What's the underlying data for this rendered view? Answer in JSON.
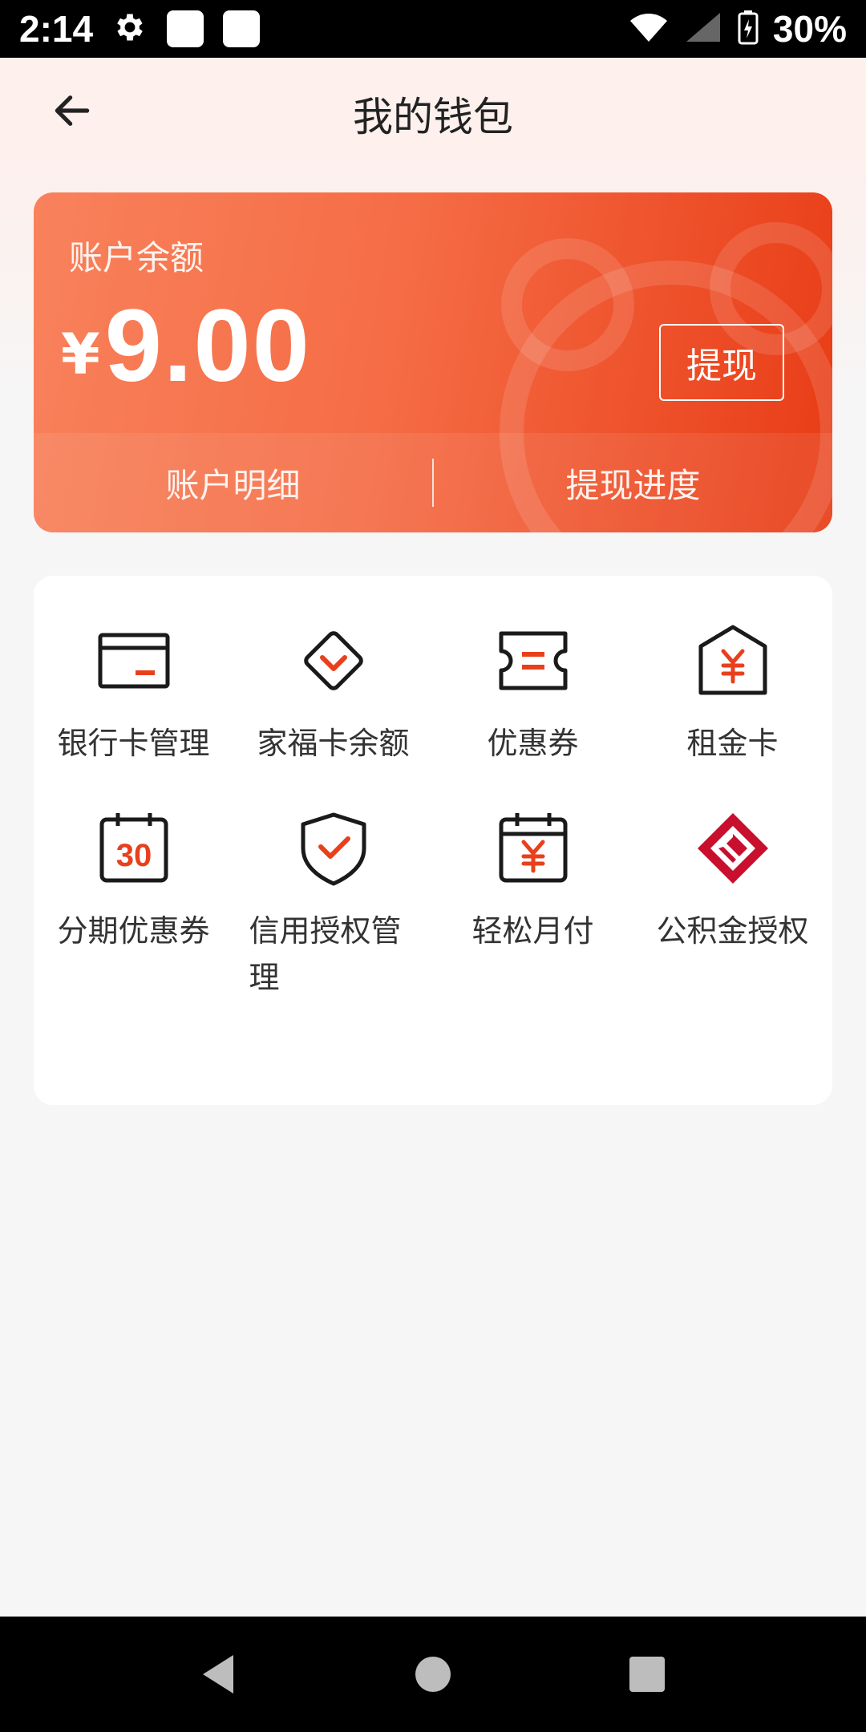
{
  "status_bar": {
    "time": "2:14",
    "battery": "30%"
  },
  "header": {
    "title": "我的钱包"
  },
  "balance_card": {
    "label": "账户余额",
    "currency": "¥",
    "amount": "9.00",
    "withdraw_label": "提现",
    "links": [
      "账户明细",
      "提现进度"
    ]
  },
  "services": {
    "items": [
      {
        "label": "银行卡管理",
        "icon": "bank-card-icon"
      },
      {
        "label": "家福卡余额",
        "icon": "diamond-card-icon"
      },
      {
        "label": "优惠券",
        "icon": "coupon-icon"
      },
      {
        "label": "租金卡",
        "icon": "rent-card-icon"
      },
      {
        "label": "分期优惠券",
        "icon": "calendar-30-icon"
      },
      {
        "label": "信用授权管理",
        "icon": "shield-check-icon"
      },
      {
        "label": "轻松月付",
        "icon": "calendar-yuan-icon"
      },
      {
        "label": "公积金授权",
        "icon": "housing-fund-logo-icon"
      }
    ]
  },
  "colors": {
    "accent": "#e8401c",
    "card_start": "#f8825c",
    "card_end": "#e83c16",
    "fund_logo": "#c8102e"
  }
}
